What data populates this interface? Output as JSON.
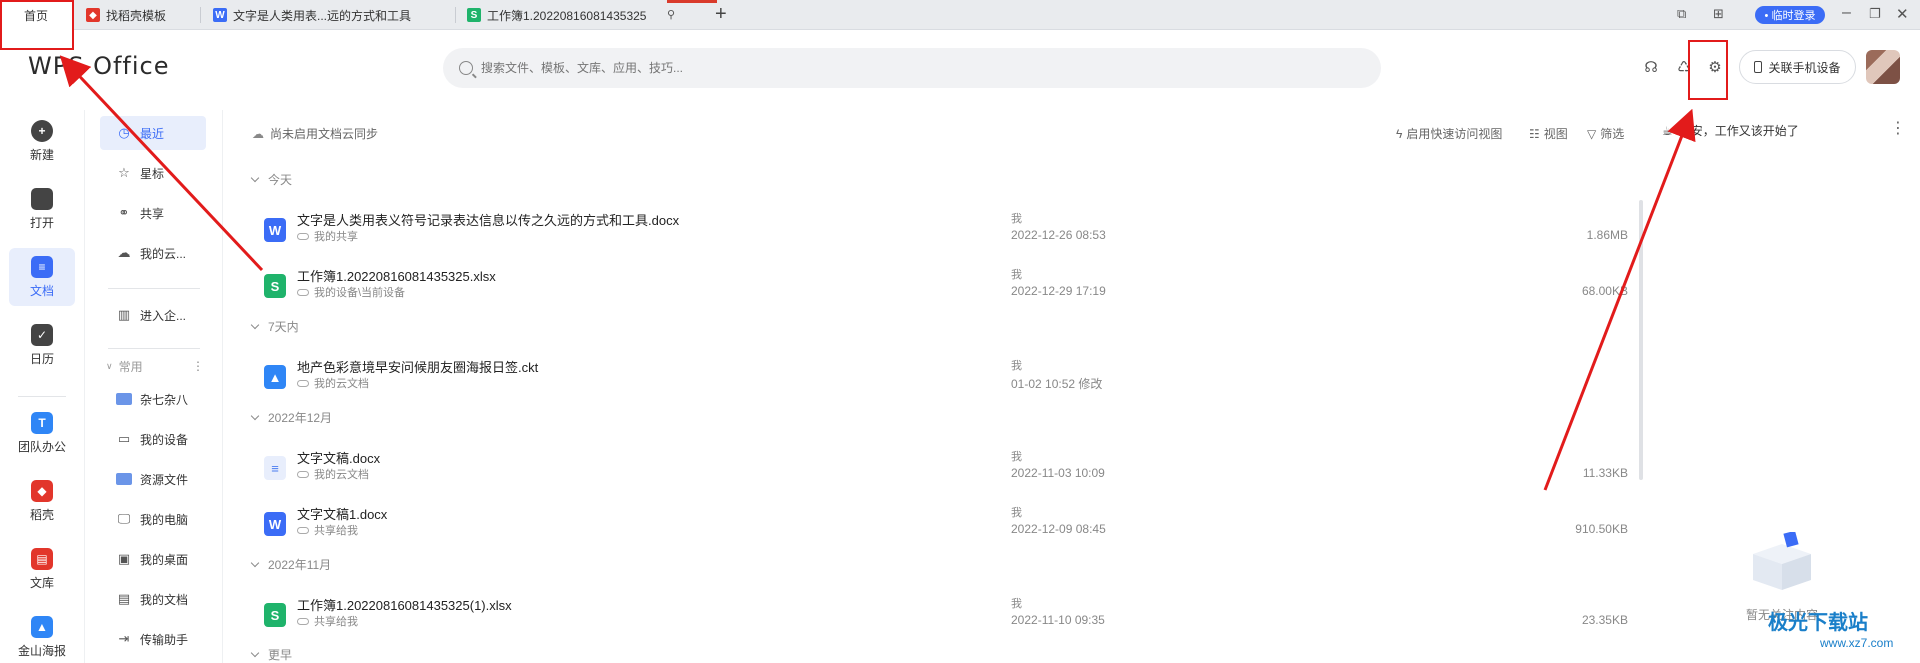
{
  "tabs": {
    "home": "首页",
    "items": [
      {
        "label": "找稻壳模板",
        "icon": "docer-icon",
        "color": "#e2362b",
        "glyph": "W"
      },
      {
        "label": "文字是人类用表...远的方式和工具",
        "icon": "wps-writer-icon",
        "color": "#3b6cf6",
        "glyph": "W"
      },
      {
        "label": "工作簿1.20220816081435325",
        "icon": "wps-sheet-icon",
        "color": "#1fb36b",
        "glyph": "S"
      }
    ],
    "add": "+"
  },
  "titlebar": {
    "login": "• 临时登录"
  },
  "header": {
    "logo": "WPS Office",
    "search_placeholder": "搜索文件、模板、文库、应用、技巧...",
    "link_phone": "关联手机设备"
  },
  "rail": [
    {
      "label": "新建",
      "color": "#444"
    },
    {
      "label": "打开",
      "color": "#444"
    },
    {
      "label": "文档",
      "color": "#3b6cf6"
    },
    {
      "label": "日历",
      "color": "#444"
    },
    {
      "label": "团队办公",
      "color": "#2f86f6"
    },
    {
      "label": "稻壳",
      "color": "#e2362b"
    },
    {
      "label": "文库",
      "color": "#e2362b"
    },
    {
      "label": "金山海报",
      "color": "#2f86f6"
    }
  ],
  "nav": {
    "recent": "最近",
    "star": "星标",
    "share": "共享",
    "cloud": "我的云...",
    "enterprise": "进入企...",
    "common": "常用",
    "folders": [
      "杂七杂八",
      "我的设备",
      "资源文件",
      "我的电脑",
      "我的桌面",
      "我的文档",
      "传输助手"
    ]
  },
  "content": {
    "cloud_sync": "尚未启用文档云同步",
    "quick_view": "启用快速访问视图",
    "view": "视图",
    "filter": "筛选",
    "groups": [
      "今天",
      "7天内",
      "2022年12月",
      "2022年11月",
      "更早"
    ],
    "files": [
      {
        "name": "文字是人类用表义符号记录表达信息以传之久远的方式和工具.docx",
        "loc": "我的共享",
        "owner": "我",
        "date": "2022-12-26 08:53",
        "size": "1.86MB",
        "icon": "writer-file-icon",
        "color": "#3b6cf6",
        "glyph": "W"
      },
      {
        "name": "工作簿1.20220816081435325.xlsx",
        "loc": "我的设备\\当前设备",
        "owner": "我",
        "date": "2022-12-29 17:19",
        "size": "68.00KB",
        "icon": "sheet-file-icon",
        "color": "#1fb36b",
        "glyph": "S"
      },
      {
        "name": "地产色彩意境早安问候朋友圈海报日签.ckt",
        "loc": "我的云文档",
        "owner": "我",
        "date": "01-02 10:52 修改",
        "size": "",
        "icon": "poster-file-icon",
        "color": "#2f86f6",
        "glyph": "▲"
      },
      {
        "name": "文字文稿.docx",
        "loc": "我的云文档",
        "owner": "我",
        "date": "2022-11-03 10:09",
        "size": "11.33KB",
        "icon": "text-file-icon",
        "color": "#4a7cf0",
        "glyph": "≡"
      },
      {
        "name": "文字文稿1.docx",
        "loc": "共享给我",
        "owner": "我",
        "date": "2022-12-09 08:45",
        "size": "910.50KB",
        "icon": "writer-file-icon",
        "color": "#3b6cf6",
        "glyph": "W"
      },
      {
        "name": "工作簿1.20220816081435325(1).xlsx",
        "loc": "共享给我",
        "owner": "我",
        "date": "2022-11-10 09:35",
        "size": "23.35KB",
        "icon": "sheet-file-icon",
        "color": "#1fb36b",
        "glyph": "S"
      }
    ]
  },
  "right_panel": {
    "greeting": "早安，工作又该开始了",
    "empty": "暂无关注内容"
  },
  "watermark": {
    "brand": "极光下载站",
    "url": "www.xz7.com"
  },
  "colors": {
    "accent": "#3b6cf6",
    "annotation": "#e21b1b"
  }
}
